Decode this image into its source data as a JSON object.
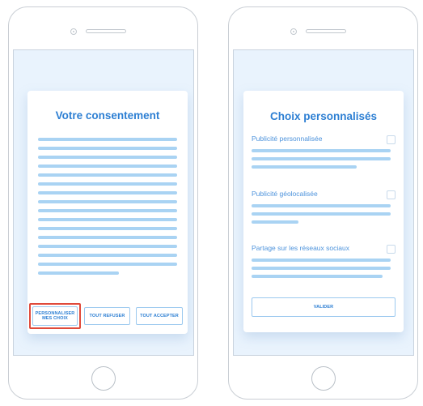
{
  "left_screen": {
    "title": "Votre consentement",
    "buttons": {
      "personalize": "PERSONNALISER\nMES CHOIX",
      "refuse_all": "TOUT REFUSER",
      "accept_all": "TOUT ACCEPTER"
    },
    "highlighted_button": "personalize",
    "highlight_color": "#e04a3b"
  },
  "right_screen": {
    "title": "Choix personnalisés",
    "options": [
      {
        "label": "Publicité personnalisée",
        "checked": false
      },
      {
        "label": "Publicité géolocalisée",
        "checked": false
      },
      {
        "label": "Partage sur les réseaux sociaux",
        "checked": false
      }
    ],
    "validate_button": "VALIDER"
  },
  "colors": {
    "accent": "#2d7fd3",
    "placeholder": "#a9d3f3",
    "screen_background": "#e9f3fd"
  }
}
